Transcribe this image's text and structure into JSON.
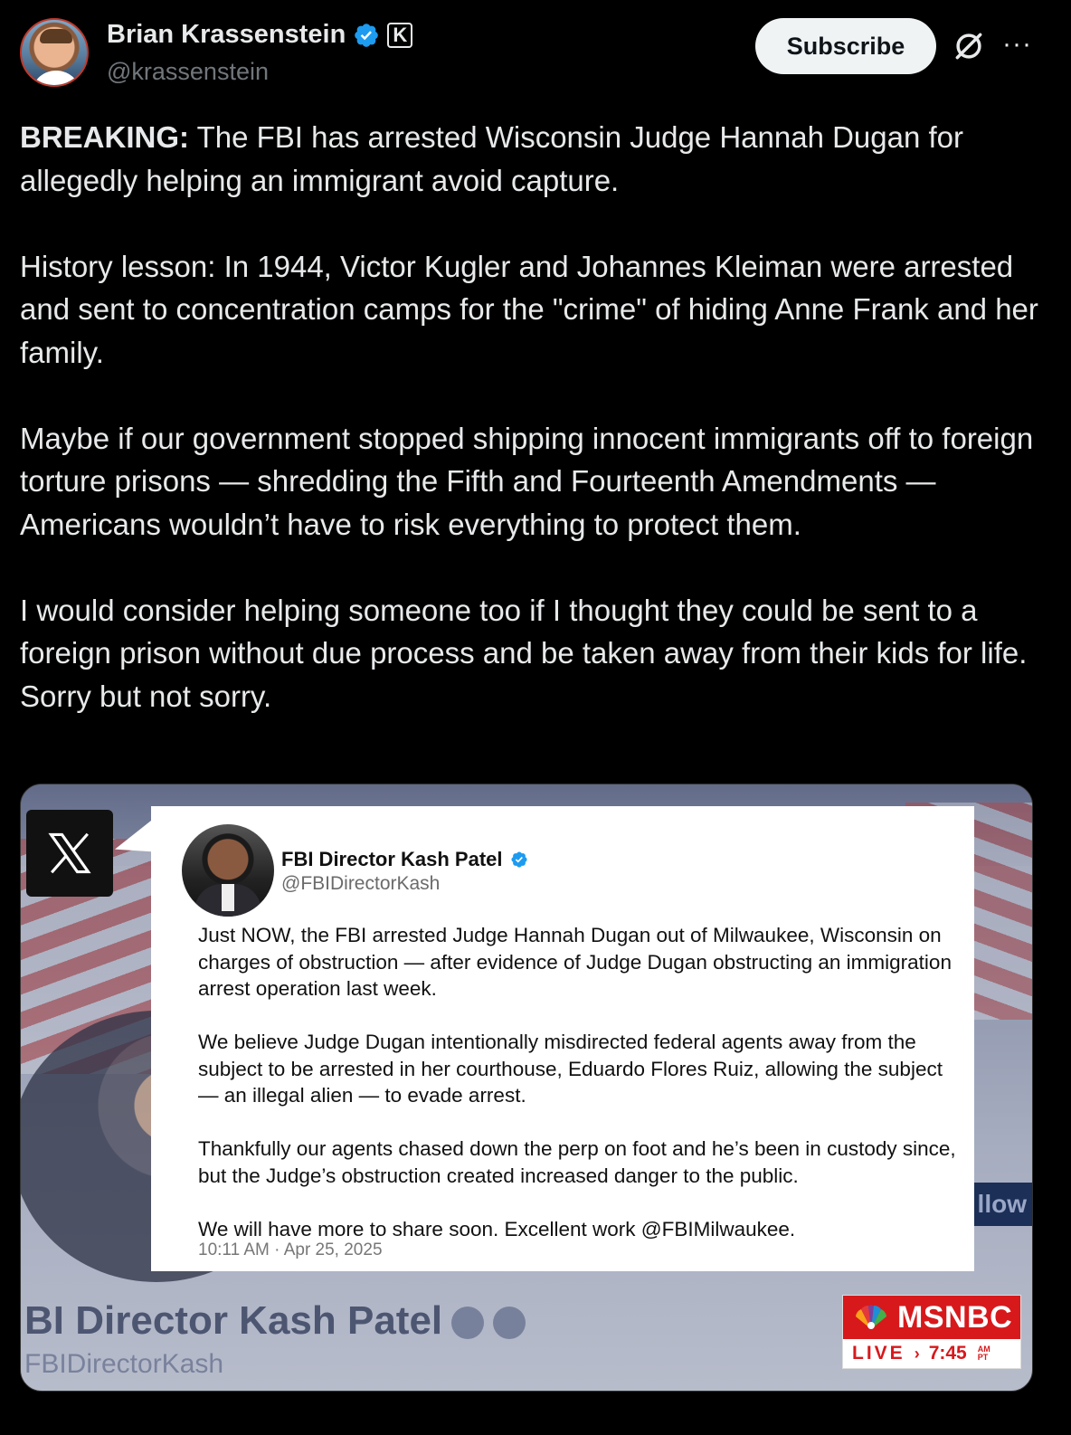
{
  "author": {
    "display_name": "Brian Krassenstein",
    "handle": "@krassenstein",
    "affiliate_badge": "K"
  },
  "actions": {
    "subscribe_label": "Subscribe",
    "more_label": "···"
  },
  "tweet": {
    "lead_bold": "BREAKING:",
    "lead_rest": " The FBI has arrested Wisconsin Judge Hannah Dugan for allegedly helping an immigrant avoid capture.",
    "p2": "History lesson: In 1944, Victor Kugler and Johannes Kleiman were arrested and sent to concentration camps for the \"crime\" of hiding Anne Frank and her family.",
    "p3": "Maybe if our government stopped shipping innocent immigrants off to foreign torture prisons — shredding the Fifth and Fourteenth Amendments — Americans wouldn’t have to risk everything to protect them.",
    "p4": "I would consider helping someone too if I thought they could be sent to a foreign prison without due process and be taken away from their kids for life.  Sorry but not sorry."
  },
  "media": {
    "embedded_post": {
      "name": "FBI Director Kash Patel",
      "handle": "@FBIDirectorKash",
      "body": "Just NOW, the FBI arrested Judge Hannah Dugan out of Milwaukee, Wisconsin on charges of obstruction — after evidence of Judge Dugan obstructing an immigration arrest operation last week.\n\nWe believe Judge Dugan intentionally misdirected federal agents away from the subject to be arrested in her courthouse, Eduardo Flores Ruiz, allowing the subject — an illegal alien — to evade arrest.\n\nThankfully our agents chased down the perp on foot and he’s been in custody since, but the Judge’s obstruction created increased danger to the public.\n\nWe will have more to share soon. Excellent work @FBIMilwaukee.",
      "timestamp": "10:11 AM · Apr 25, 2025"
    },
    "background_name": "BI Director Kash Patel",
    "background_handle": "FBIDirectorKash",
    "background_follow": "llow",
    "msnbc": {
      "brand": "MSNBC",
      "live": "LIVE",
      "chevron": "›",
      "time": "7:45",
      "am": "AM",
      "pt": "PT"
    }
  },
  "colors": {
    "background": "#000000",
    "text": "#e7e9ea",
    "secondary_text": "#71767b",
    "verified_blue": "#1d9bf0",
    "msnbc_red": "#d7191c"
  },
  "icons": [
    "verified-badge-icon",
    "affiliate-k-icon",
    "grok-icon",
    "more-icon",
    "x-logo-icon",
    "msnbc-peacock-icon"
  ]
}
